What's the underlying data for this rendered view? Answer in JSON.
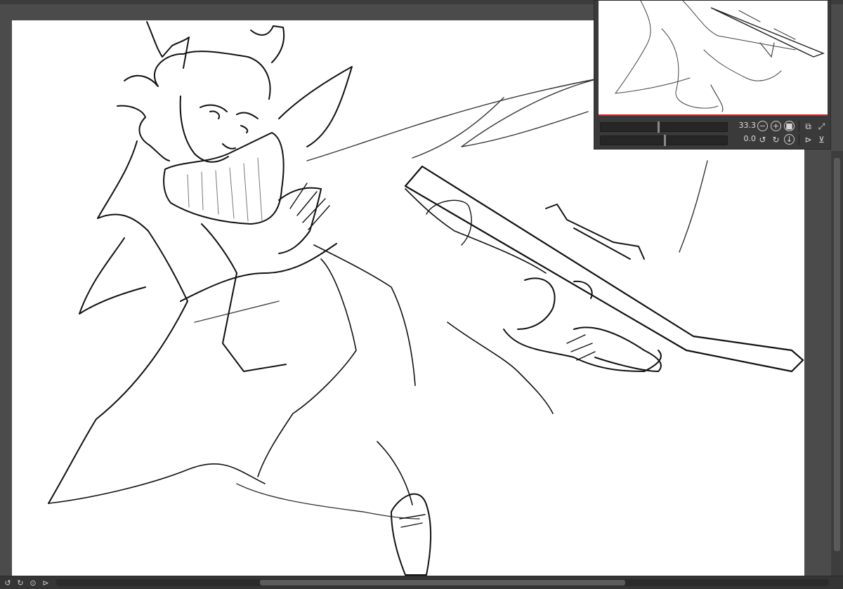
{
  "app": {
    "accent_color": "#d02424",
    "canvas_background": "#ffffff",
    "workspace_color": "#4b4b4b"
  },
  "navigator": {
    "zoom_value": "33.3",
    "rotation_value": "0.0",
    "zoom_slider_fraction": 0.45,
    "rotation_slider_fraction": 0.5,
    "icons": {
      "zoom_out": "zoom-out-icon",
      "zoom_in": "zoom-in-icon",
      "zoom_stop": "stop-icon",
      "fit": "fit-window-icon",
      "actual": "actual-size-icon",
      "rotate_left": "rotate-left-icon",
      "rotate_right": "rotate-right-icon",
      "reset_rotation": "reset-rotation-icon",
      "flip_h": "flip-horizontal-icon",
      "flip_v": "flip-vertical-icon"
    }
  },
  "statusbar": {
    "icons": [
      "rotate-left-icon",
      "rotate-right-icon",
      "reset-rotation-icon"
    ]
  }
}
